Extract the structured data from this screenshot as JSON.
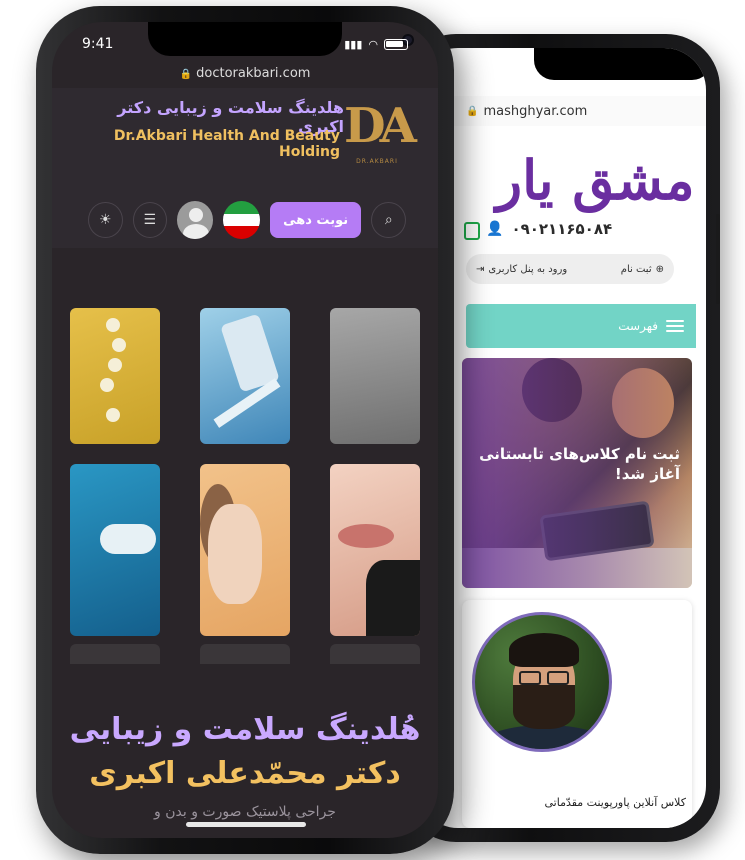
{
  "back_phone": {
    "url": "mashghyar.com",
    "logo_text": "مشق یار",
    "phone_number": "۰۹۰۲۱۱۶۵۰۸۴",
    "auth": {
      "register": "ثبت نام",
      "login": "ورود به پنل کاربری"
    },
    "menu_label": "فهرست",
    "banner_text": "ثبت نام کلاس‌های تابستانی آغاز شد!",
    "card_title": "کلاس آنلاین پاورپوینت مقدّماتی",
    "accent": "#6a2ea0",
    "menu_color": "#72d4c6"
  },
  "front_phone": {
    "time": "9:41",
    "url": "doctorakbari.com",
    "logo_mark": "DA",
    "logo_sub": "DR.AKBARI",
    "brand_fa": "هلدینگ سلامت و زیبایی دکتر اکبری",
    "brand_en": "Dr.Akbari Health And Beauty Holding",
    "appointment_label": "نوبت دهی",
    "hero_line1": "هُلدینگ سلامت و زیبایی",
    "hero_line2": "دکتر محمّدعلی اکبری",
    "hero_line3": "جراحی پلاستیک صورت و بدن و",
    "accent_purple": "#b57cf5",
    "accent_gold": "#f3c160"
  }
}
